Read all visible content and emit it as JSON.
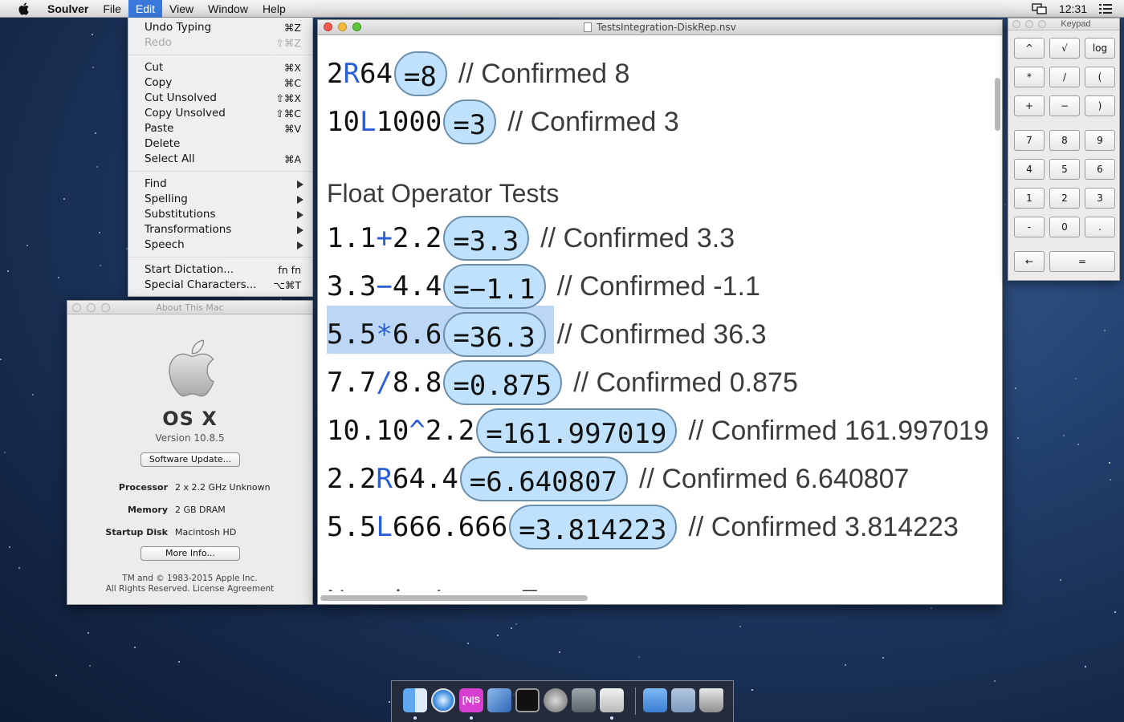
{
  "menubar": {
    "app": "Soulver",
    "menus": [
      "File",
      "Edit",
      "View",
      "Window",
      "Help"
    ],
    "clock": "12:31"
  },
  "edit_menu": {
    "items": [
      {
        "label": "Undo Typing",
        "shortcut": "⌘Z",
        "enabled": true
      },
      {
        "label": "Redo",
        "shortcut": "⇧⌘Z",
        "enabled": false
      },
      {
        "label": "Cut",
        "shortcut": "⌘X",
        "enabled": true
      },
      {
        "label": "Copy",
        "shortcut": "⌘C",
        "enabled": true
      },
      {
        "label": "Cut Unsolved",
        "shortcut": "⇧⌘X",
        "enabled": true
      },
      {
        "label": "Copy Unsolved",
        "shortcut": "⇧⌘C",
        "enabled": true
      },
      {
        "label": "Paste",
        "shortcut": "⌘V",
        "enabled": true
      },
      {
        "label": "Delete",
        "shortcut": "",
        "enabled": true
      },
      {
        "label": "Select All",
        "shortcut": "⌘A",
        "enabled": true
      },
      {
        "label": "Find",
        "submenu": true
      },
      {
        "label": "Spelling",
        "submenu": true
      },
      {
        "label": "Substitutions",
        "submenu": true
      },
      {
        "label": "Transformations",
        "submenu": true
      },
      {
        "label": "Speech",
        "submenu": true
      },
      {
        "label": "Start Dictation...",
        "shortcut": "fn fn"
      },
      {
        "label": "Special Characters...",
        "shortcut": "⌥⌘T"
      }
    ]
  },
  "about": {
    "window_title": "About This Mac",
    "os_name": "OS X",
    "version": "Version 10.8.5",
    "update_button": "Software Update...",
    "specs": [
      {
        "label": "Processor",
        "value": "2 x 2.2 GHz Unknown"
      },
      {
        "label": "Memory",
        "value": "2 GB DRAM"
      },
      {
        "label": "Startup Disk",
        "value": "Macintosh HD"
      }
    ],
    "more_button": "More Info...",
    "legal_1": "TM and © 1983-2015 Apple Inc.",
    "legal_2": "All Rights Reserved.  License Agreement"
  },
  "document": {
    "title": "TestsIntegration-DiskRep.nsv",
    "lines": [
      {
        "a": "2",
        "op": "R",
        "b": "64",
        "answer": "=8",
        "comment": "// Confirmed 8"
      },
      {
        "a": "10",
        "op": "L",
        "b": "1000",
        "answer": "=3",
        "comment": "// Confirmed 3"
      }
    ],
    "section_float": "Float Operator Tests",
    "float_lines": [
      {
        "a": "1.1",
        "op": "+",
        "b": "2.2",
        "answer": "=3.3",
        "comment": "// Confirmed 3.3"
      },
      {
        "a": "3.3",
        "op": "−",
        "b": "4.4",
        "answer": "=−1.1",
        "comment": "// Confirmed -1.1"
      },
      {
        "a": "5.5",
        "op": "*",
        "b": "6.6",
        "answer": "=36.3",
        "comment": "// Confirmed 36.3"
      },
      {
        "a": "7.7",
        "op": "/",
        "b": "8.8",
        "answer": "=0.875",
        "comment": "// Confirmed 0.875"
      },
      {
        "a": "10.10",
        "op": "^",
        "b": "2.2",
        "answer": "=161.997019",
        "comment": "// Confirmed 161.997019"
      },
      {
        "a": "2.2",
        "op": "R",
        "b": "64.4",
        "answer": "=6.640807",
        "comment": "// Confirmed 6.640807"
      },
      {
        "a": "5.5",
        "op": "L",
        "b": "666.666",
        "answer": "=3.814223",
        "comment": "// Confirmed 3.814223"
      }
    ],
    "section_negative": "Negative Integer Tests"
  },
  "keypad": {
    "title": "Keypad",
    "keys": [
      "^",
      "√",
      "log",
      "*",
      "/",
      "(",
      "+",
      "−",
      ")",
      "7",
      "8",
      "9",
      "4",
      "5",
      "6",
      "1",
      "2",
      "3",
      "-",
      "0",
      ".",
      "←",
      "="
    ]
  },
  "dock": {
    "icons": [
      "finder-icon",
      "safari-icon",
      "ns-app-icon",
      "xcode-icon",
      "terminal-icon",
      "system-preferences-icon",
      "network-utility-icon",
      "instruments-icon",
      "applications-folder-icon",
      "downloads-folder-icon",
      "trash-icon"
    ]
  }
}
